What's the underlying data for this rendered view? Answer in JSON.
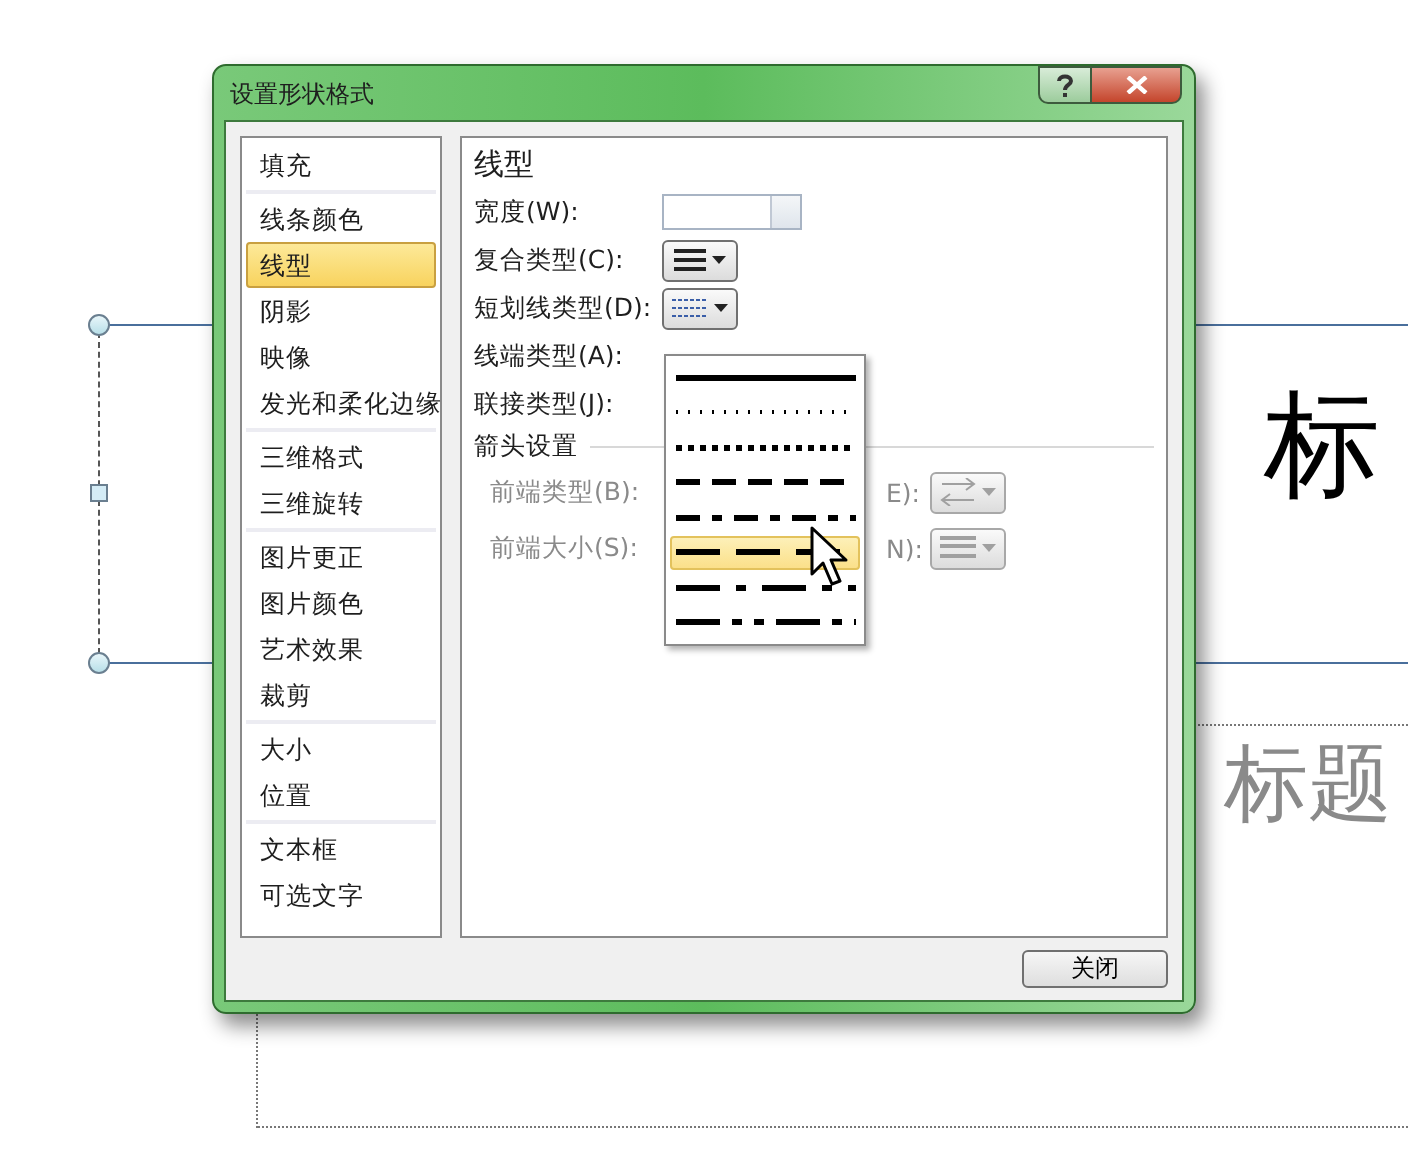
{
  "slide": {
    "title_fragment": "标",
    "subtitle_fragment": "标题"
  },
  "window": {
    "title": "设置形状格式"
  },
  "sidebar": {
    "groups": [
      {
        "items": [
          {
            "label": "填充",
            "selected": false
          }
        ]
      },
      {
        "items": [
          {
            "label": "线条颜色",
            "selected": false
          },
          {
            "label": "线型",
            "selected": true
          },
          {
            "label": "阴影",
            "selected": false
          },
          {
            "label": "映像",
            "selected": false
          },
          {
            "label": "发光和柔化边缘",
            "selected": false
          }
        ]
      },
      {
        "items": [
          {
            "label": "三维格式",
            "selected": false
          },
          {
            "label": "三维旋转",
            "selected": false
          }
        ]
      },
      {
        "items": [
          {
            "label": "图片更正",
            "selected": false
          },
          {
            "label": "图片颜色",
            "selected": false
          },
          {
            "label": "艺术效果",
            "selected": false
          },
          {
            "label": "裁剪",
            "selected": false
          }
        ]
      },
      {
        "items": [
          {
            "label": "大小",
            "selected": false
          },
          {
            "label": "位置",
            "selected": false
          }
        ]
      },
      {
        "items": [
          {
            "label": "文本框",
            "selected": false
          },
          {
            "label": "可选文字",
            "selected": false
          }
        ]
      }
    ]
  },
  "panel": {
    "heading": "线型",
    "fields": [
      {
        "label": "宽度(W):",
        "kind": "spinner"
      },
      {
        "label": "复合类型(C):",
        "kind": "compound"
      },
      {
        "label": "短划线类型(D):",
        "kind": "dash"
      },
      {
        "label": "线端类型(A):",
        "kind": "covered"
      },
      {
        "label": "联接类型(J):",
        "kind": "covered"
      }
    ],
    "section": "箭头设置",
    "arrow_rows": [
      {
        "label": "前端类型(B):",
        "trail": "E):",
        "kind": "arrows",
        "disabled": true
      },
      {
        "label": "前端大小(S):",
        "trail": "N):",
        "kind": "sizes",
        "disabled": true
      }
    ]
  },
  "dash_menu": [
    {
      "kind": "solid",
      "selected": false
    },
    {
      "kind": "round-dot",
      "selected": false
    },
    {
      "kind": "square-dot",
      "selected": false
    },
    {
      "kind": "dash",
      "selected": false
    },
    {
      "kind": "dash-dot",
      "selected": false
    },
    {
      "kind": "long-dash",
      "selected": true
    },
    {
      "kind": "long-dash-dot",
      "selected": false
    },
    {
      "kind": "long-dash-dot-dot",
      "selected": false
    }
  ],
  "buttons": [
    "关闭"
  ]
}
